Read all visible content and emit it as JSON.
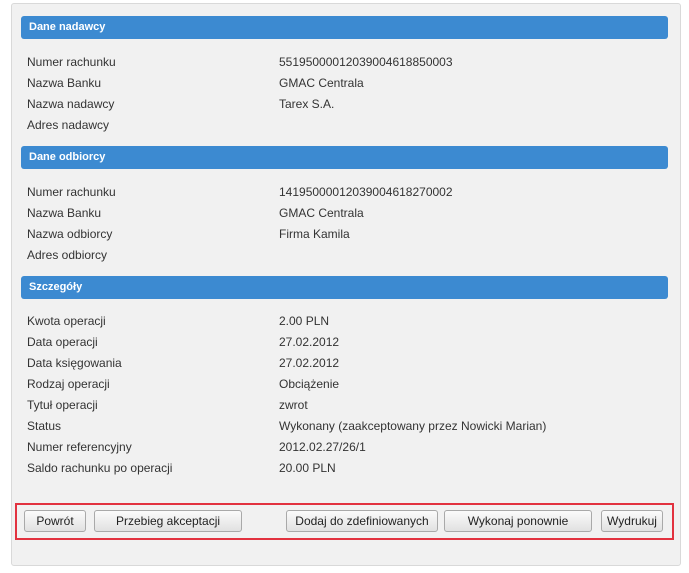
{
  "sender": {
    "header": "Dane nadawcy",
    "rows": [
      {
        "label": "Numer rachunku",
        "value": "55195000012039004618850003"
      },
      {
        "label": "Nazwa Banku",
        "value": "GMAC Centrala"
      },
      {
        "label": "Nazwa nadawcy",
        "value": "Tarex S.A."
      },
      {
        "label": "Adres nadawcy",
        "value": ""
      }
    ]
  },
  "recipient": {
    "header": "Dane odbiorcy",
    "rows": [
      {
        "label": "Numer rachunku",
        "value": "14195000012039004618270002"
      },
      {
        "label": "Nazwa Banku",
        "value": "GMAC Centrala"
      },
      {
        "label": "Nazwa odbiorcy",
        "value": "Firma Kamila"
      },
      {
        "label": "Adres odbiorcy",
        "value": ""
      }
    ]
  },
  "details": {
    "header": "Szczegóły",
    "rows": [
      {
        "label": "Kwota operacji",
        "value": "2.00 PLN"
      },
      {
        "label": "Data operacji",
        "value": "27.02.2012"
      },
      {
        "label": "Data księgowania",
        "value": "27.02.2012"
      },
      {
        "label": "Rodzaj operacji",
        "value": "Obciążenie"
      },
      {
        "label": "Tytuł operacji",
        "value": "zwrot"
      },
      {
        "label": "Status",
        "value": "Wykonany (zaakceptowany przez Nowicki Marian)"
      },
      {
        "label": "Numer referencyjny",
        "value": "2012.02.27/26/1"
      },
      {
        "label": "Saldo rachunku po operacji",
        "value": "20.00 PLN"
      }
    ]
  },
  "buttons": {
    "back": "Powrót",
    "acceptance": "Przebieg akceptacji",
    "add_defined": "Dodaj do zdefiniowanych",
    "repeat": "Wykonaj ponownie",
    "print": "Wydrukuj"
  },
  "colors": {
    "header_bg": "#3c8ad1",
    "highlight_border": "#e2323f"
  }
}
